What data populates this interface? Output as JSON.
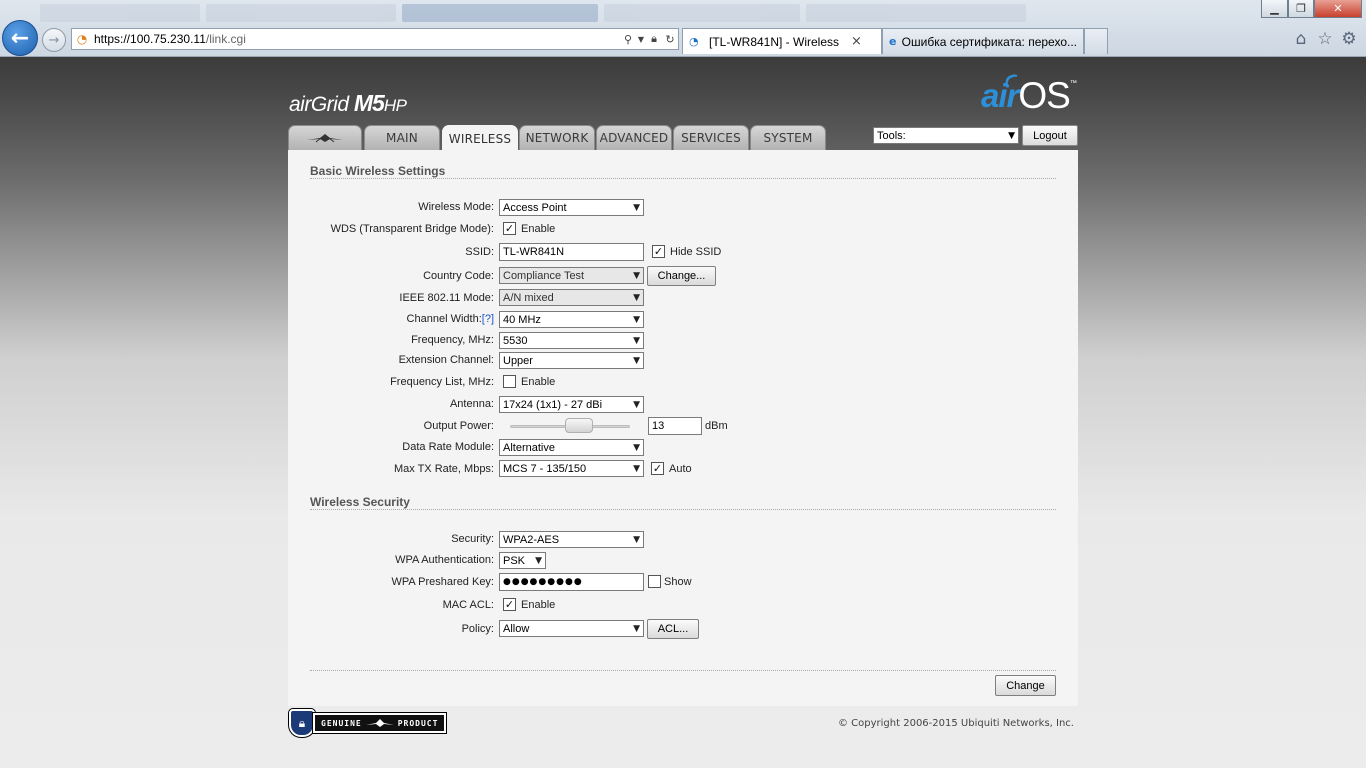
{
  "browser": {
    "address": "https://100.75.230.11/link.cgi",
    "address_host": "https://100.75.230.11",
    "address_path": "/link.cgi",
    "tabs": [
      {
        "title": "[TL-WR841N] - Wireless",
        "active": true
      },
      {
        "title": "Ошибка сертификата: перехо...",
        "active": false
      }
    ]
  },
  "header": {
    "product_air": "air",
    "product_grid": "Grid",
    "product_m": "M5",
    "product_hp": "HP",
    "brand_air": "air",
    "brand_os": "OS",
    "brand_tm": "™"
  },
  "nav": {
    "tabs": [
      {
        "id": "logo",
        "label": ""
      },
      {
        "id": "main",
        "label": "MAIN"
      },
      {
        "id": "wireless",
        "label": "WIRELESS"
      },
      {
        "id": "network",
        "label": "NETWORK"
      },
      {
        "id": "advanced",
        "label": "ADVANCED"
      },
      {
        "id": "services",
        "label": "SERVICES"
      },
      {
        "id": "system",
        "label": "SYSTEM"
      }
    ],
    "active": "wireless",
    "tools_label": "Tools:",
    "logout_label": "Logout"
  },
  "basic": {
    "title": "Basic Wireless Settings",
    "wireless_mode": {
      "label": "Wireless Mode:",
      "value": "Access Point"
    },
    "wds": {
      "label": "WDS (Transparent Bridge Mode):",
      "checked": true,
      "option": "Enable"
    },
    "ssid": {
      "label": "SSID:",
      "value": "TL-WR841N",
      "hide_checked": true,
      "hide_label": "Hide SSID"
    },
    "country": {
      "label": "Country Code:",
      "value": "Compliance Test",
      "button": "Change..."
    },
    "ieee": {
      "label": "IEEE 802.11 Mode:",
      "value": "A/N mixed"
    },
    "channel_width": {
      "label": "Channel Width:",
      "help": "[?]",
      "value": "40 MHz"
    },
    "frequency": {
      "label": "Frequency, MHz:",
      "value": "5530"
    },
    "extension": {
      "label": "Extension Channel:",
      "value": "Upper"
    },
    "freq_list": {
      "label": "Frequency List, MHz:",
      "checked": false,
      "option": "Enable"
    },
    "antenna": {
      "label": "Antenna:",
      "value": "17x24 (1x1) - 27 dBi"
    },
    "output_power": {
      "label": "Output Power:",
      "value": "13",
      "unit": "dBm",
      "slider_fraction": 0.6
    },
    "data_rate": {
      "label": "Data Rate Module:",
      "value": "Alternative"
    },
    "max_tx": {
      "label": "Max TX Rate, Mbps:",
      "value": "MCS 7 - 135/150",
      "auto_checked": true,
      "auto_label": "Auto"
    }
  },
  "security": {
    "title": "Wireless Security",
    "security": {
      "label": "Security:",
      "value": "WPA2-AES"
    },
    "wpa_auth": {
      "label": "WPA Authentication:",
      "value": "PSK"
    },
    "psk": {
      "label": "WPA Preshared Key:",
      "value": "●●●●●●●●●",
      "show_checked": false,
      "show_label": "Show"
    },
    "mac_acl": {
      "label": "MAC ACL:",
      "checked": true,
      "option": "Enable"
    },
    "policy": {
      "label": "Policy:",
      "value": "Allow",
      "button": "ACL..."
    }
  },
  "actions": {
    "change": "Change"
  },
  "footer": {
    "genuine_left": "GENUINE",
    "genuine_right": "PRODUCT",
    "copyright": "© Copyright 2006-2015 Ubiquiti Networks, Inc."
  },
  "colors": {
    "accent_blue": "#2d8fd8",
    "link": "#1a55c8"
  }
}
